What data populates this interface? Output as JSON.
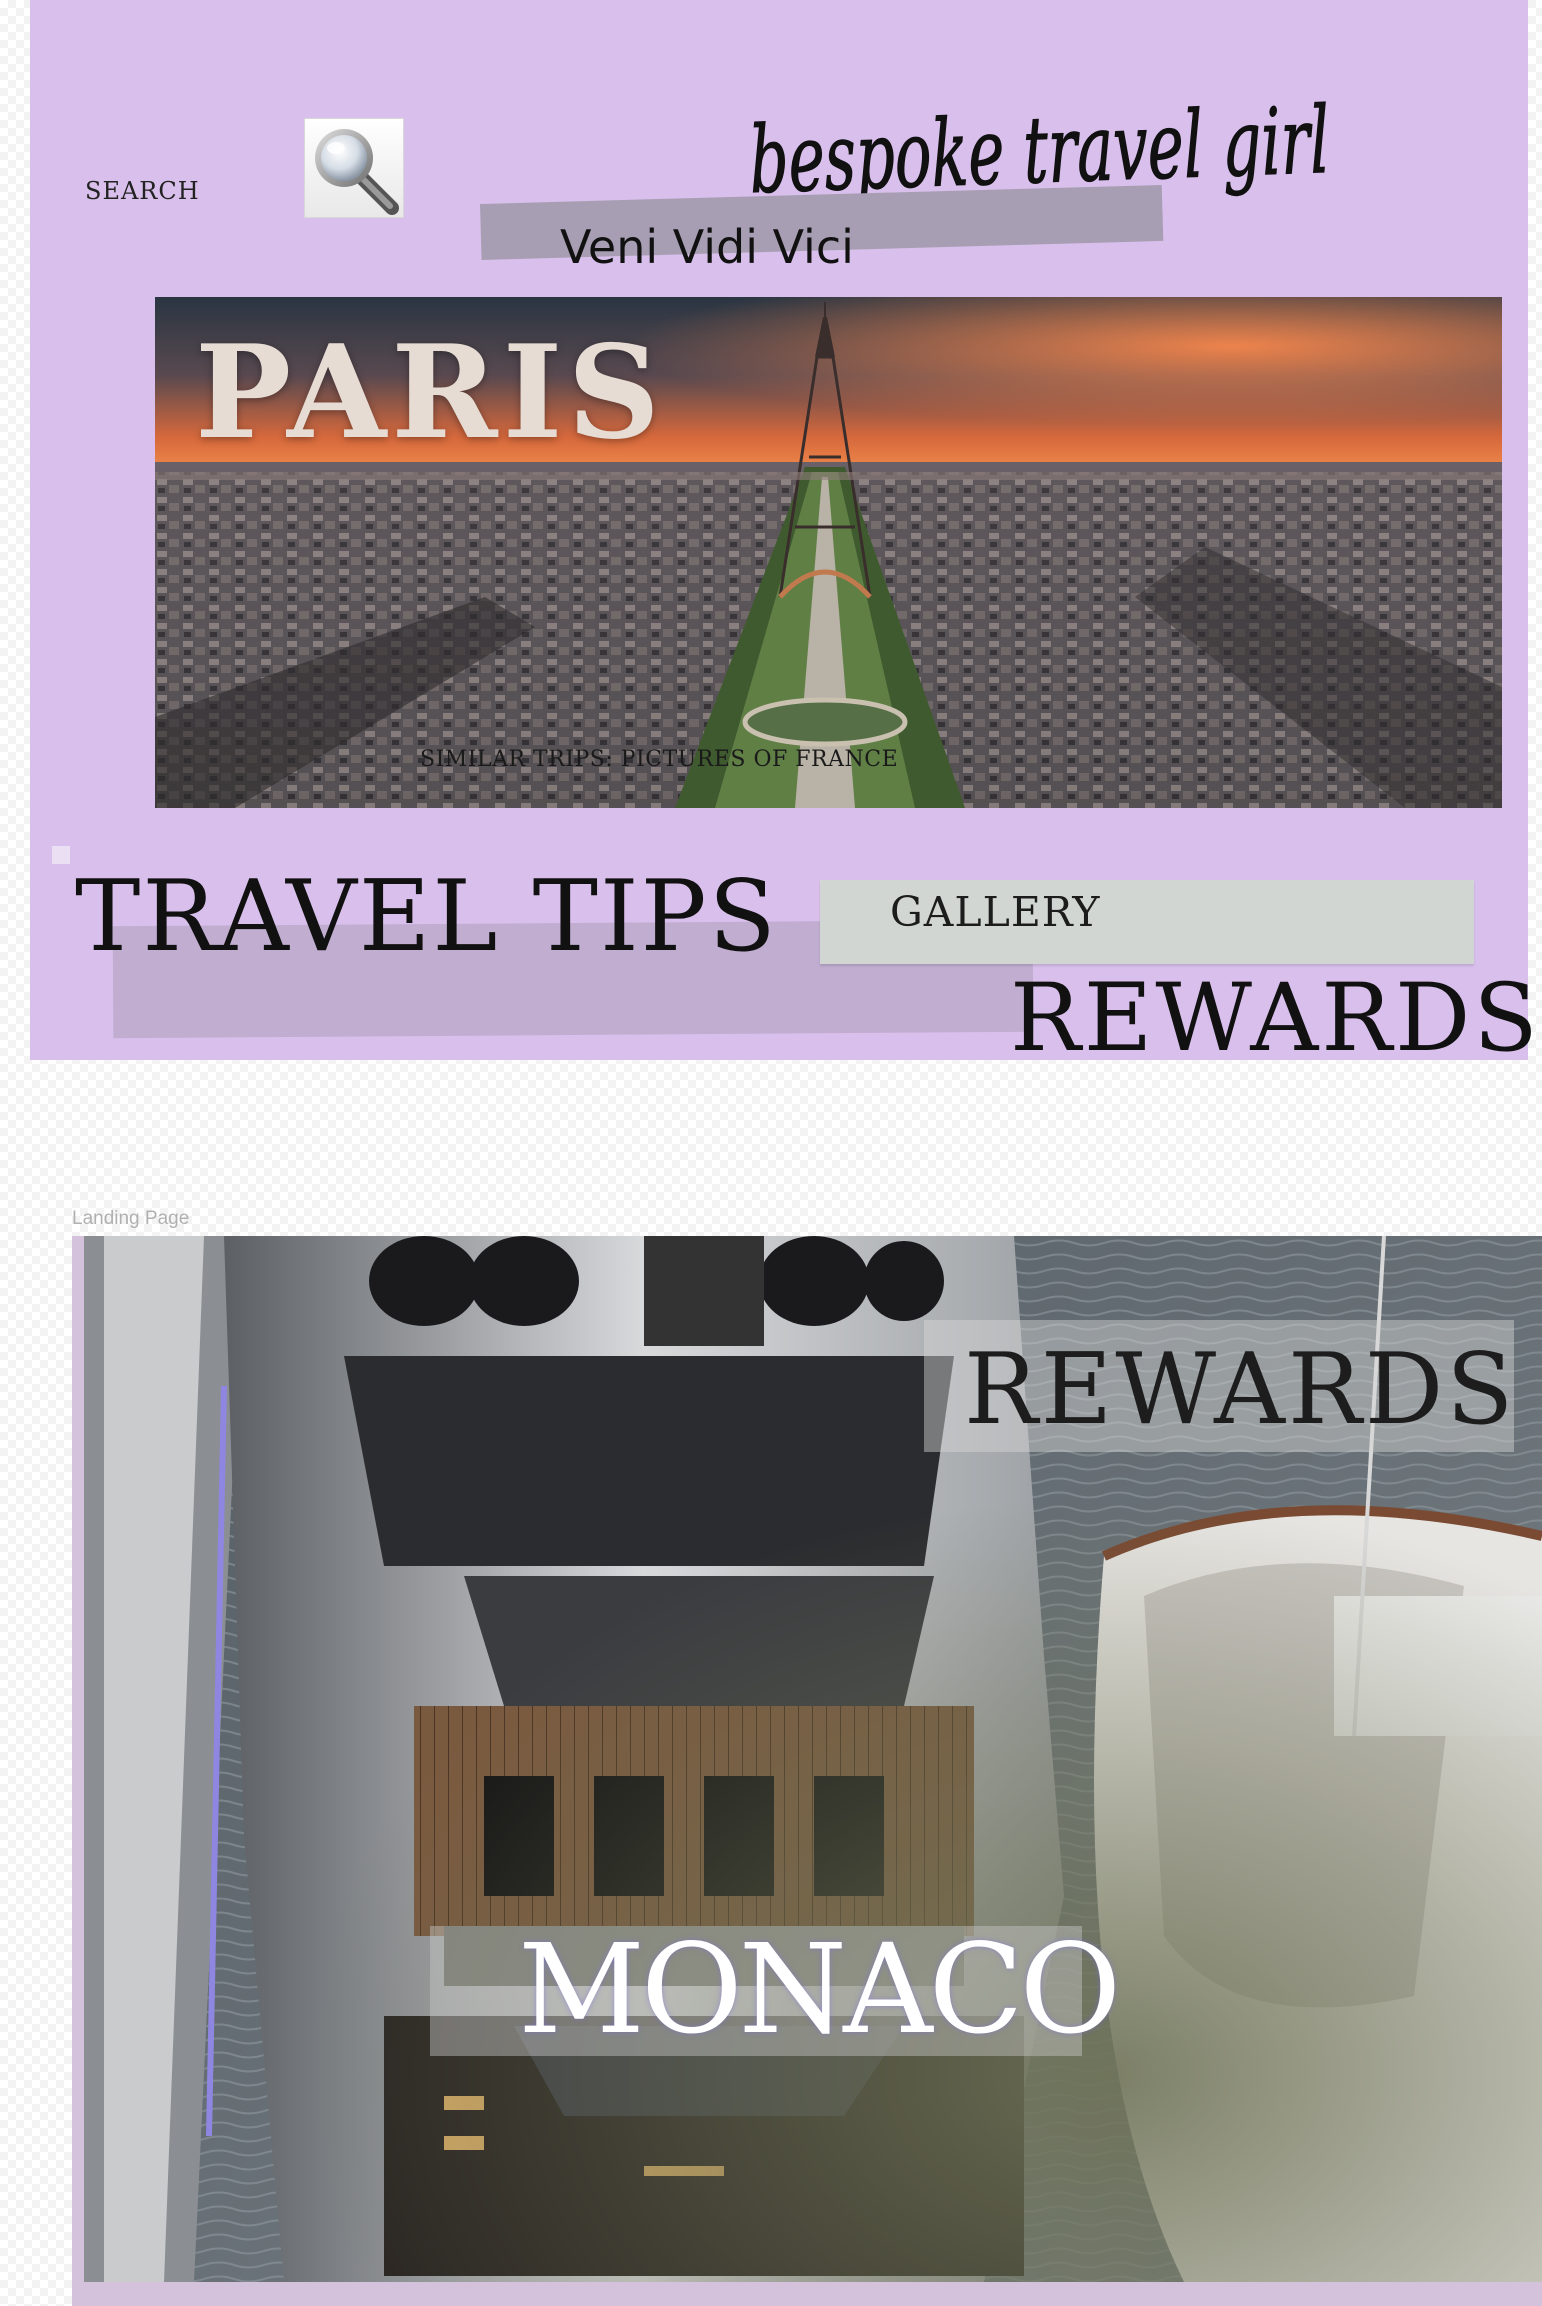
{
  "header": {
    "search_label": "SEARCH",
    "brand": "bespoke travel girl",
    "tagline": "Veni Vidi Vici"
  },
  "hero": {
    "title": "PARIS",
    "caption": "SIMILAR TRIPS: PICTURES OF FRANCE"
  },
  "nav": {
    "travel_tips": "TRAVEL TIPS",
    "gallery": "GALLERY",
    "rewards": "REWARDS"
  },
  "landing": {
    "artboard_label": "Landing Page",
    "rewards": "REWARDS",
    "title": "MONACO"
  },
  "colors": {
    "artboard_bg": "#d9c0ec",
    "tagline_strip": "#a89eb4",
    "gallery_button": "#d2d6d3"
  },
  "icons": [
    "magnifier-icon"
  ]
}
